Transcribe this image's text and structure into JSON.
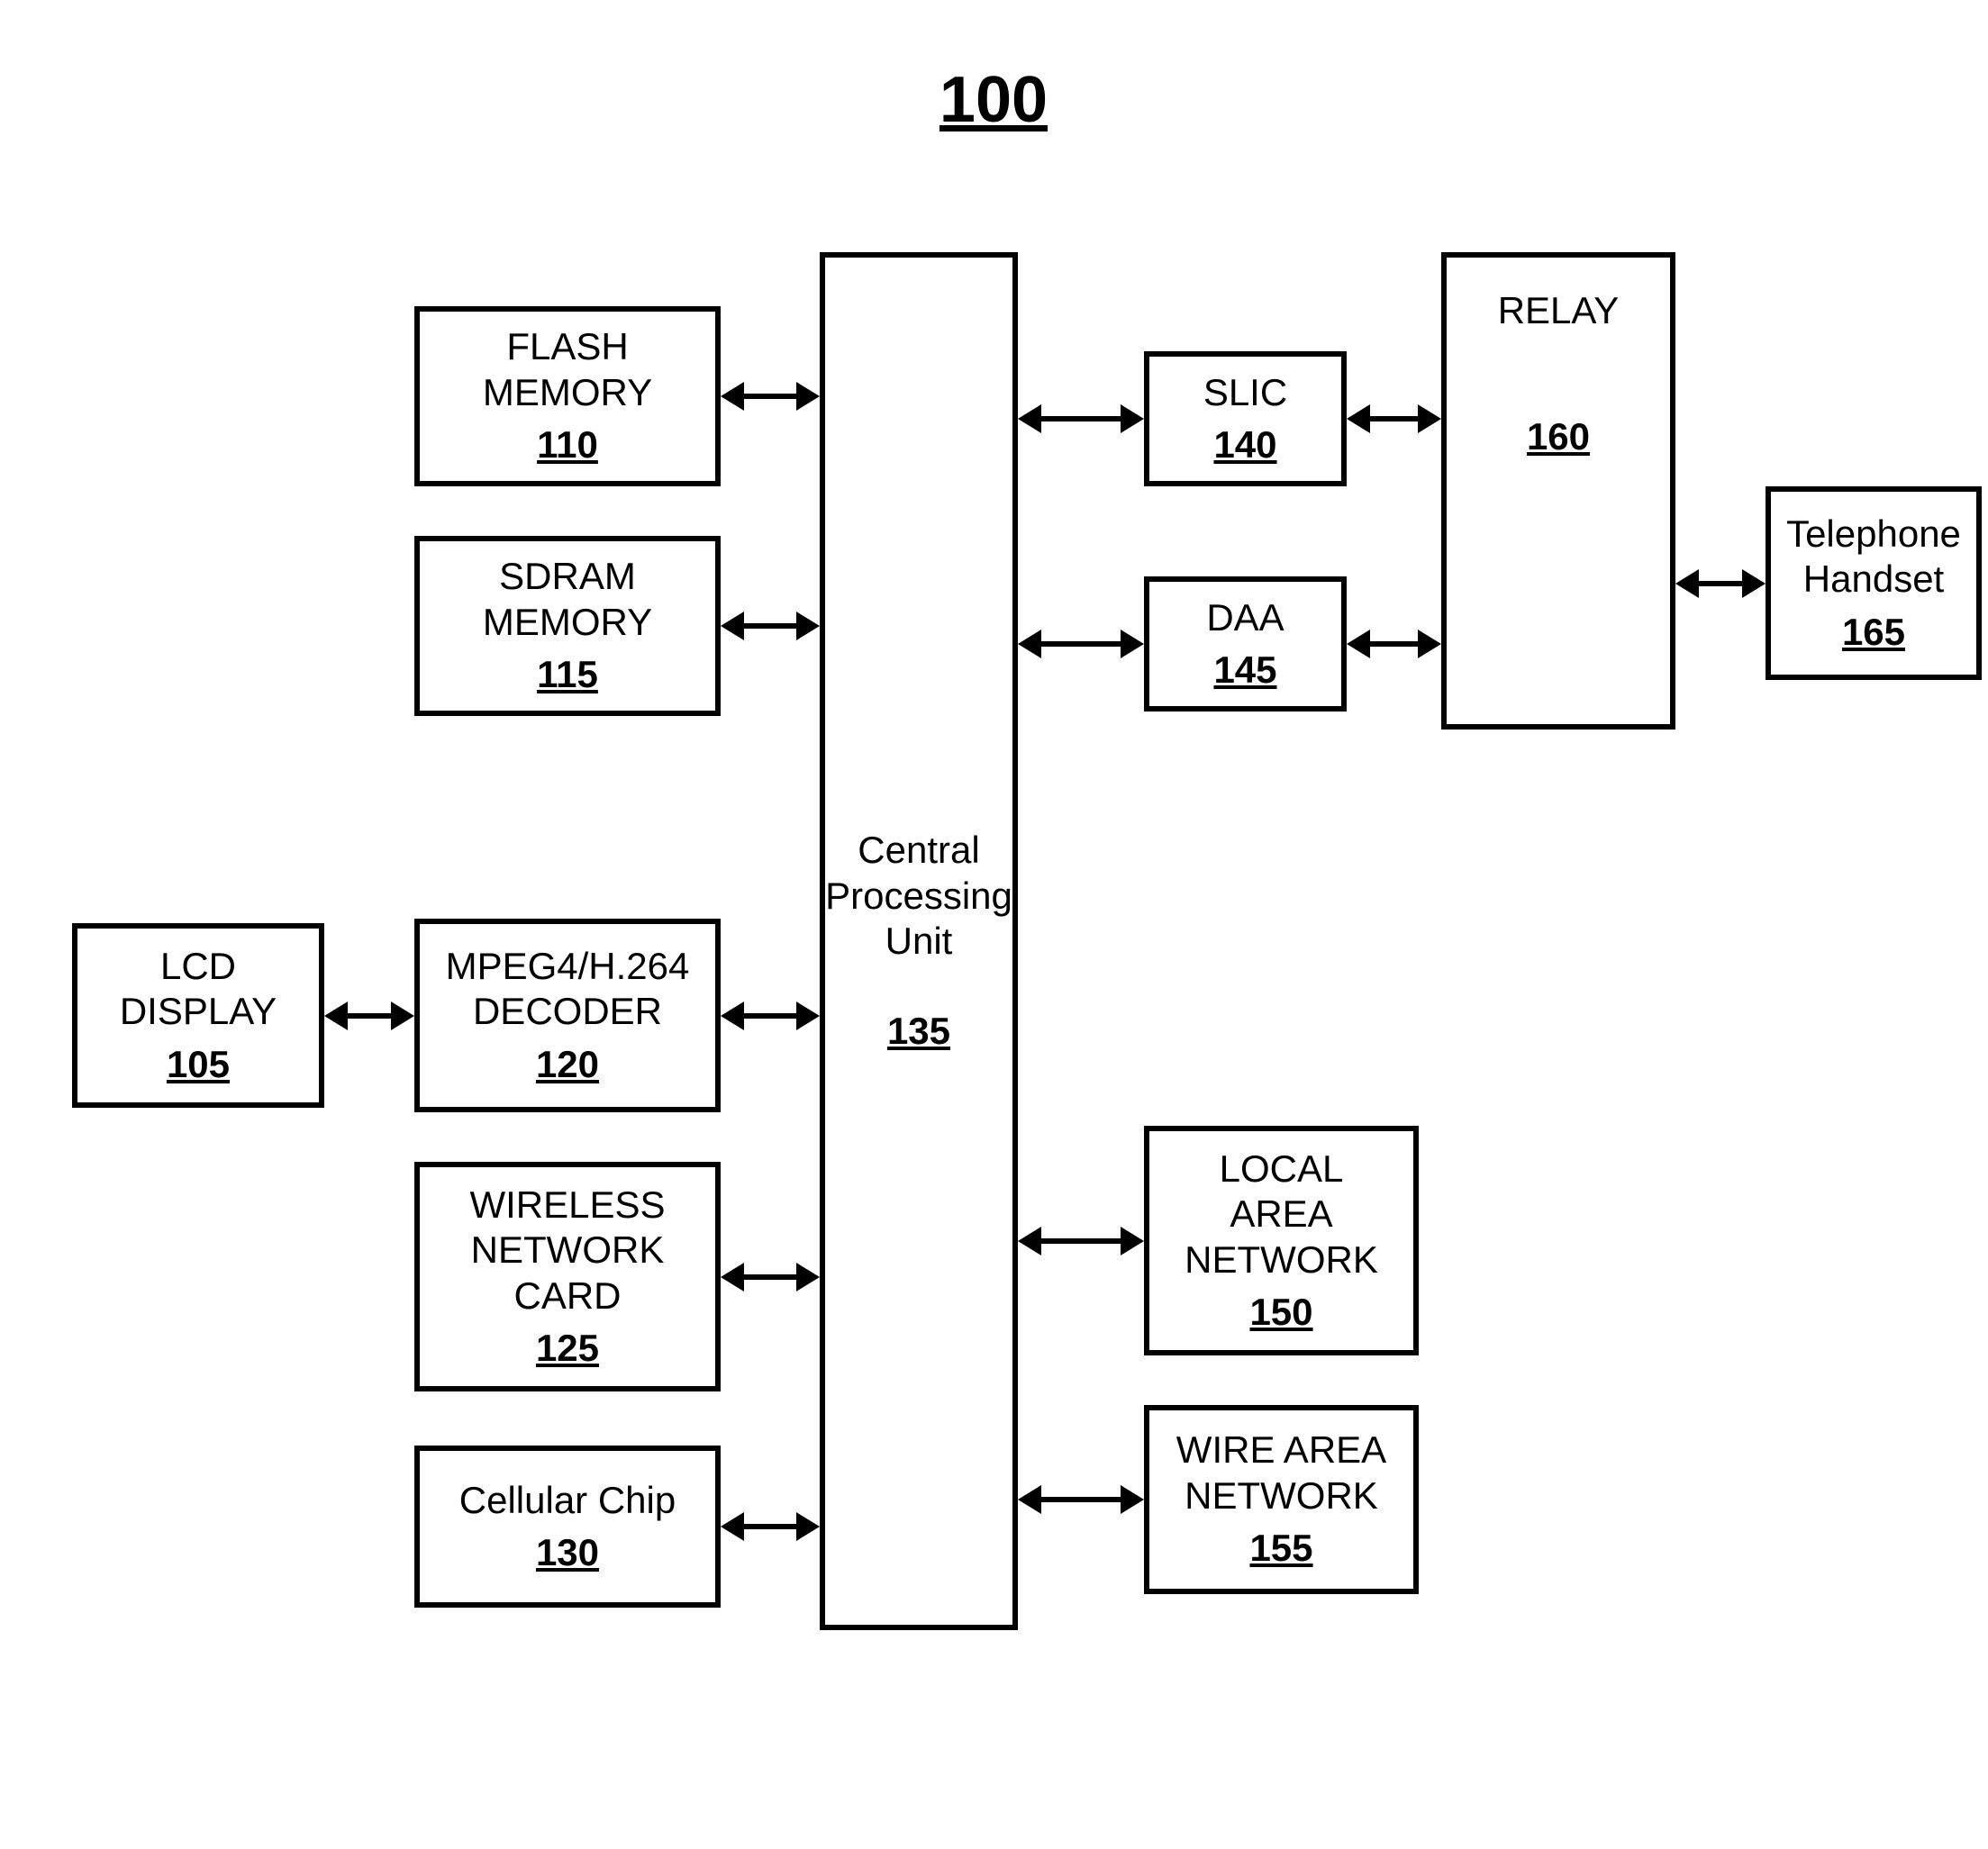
{
  "title": "100",
  "blocks": {
    "lcd": {
      "label": "LCD\nDISPLAY",
      "ref": "105"
    },
    "flash": {
      "label": "FLASH\nMEMORY",
      "ref": "110"
    },
    "sdram": {
      "label": "SDRAM\nMEMORY",
      "ref": "115"
    },
    "mpeg": {
      "label": "MPEG4/H.264\nDECODER",
      "ref": "120"
    },
    "wlan": {
      "label": "WIRELESS\nNETWORK\nCARD",
      "ref": "125"
    },
    "cell": {
      "label": "Cellular Chip",
      "ref": "130"
    },
    "cpu": {
      "label": "Central\nProcessing\nUnit",
      "ref": "135"
    },
    "slic": {
      "label": "SLIC",
      "ref": "140"
    },
    "daa": {
      "label": "DAA",
      "ref": "145"
    },
    "lan": {
      "label": "LOCAL\nAREA\nNETWORK",
      "ref": "150"
    },
    "wan": {
      "label": "WIRE AREA\nNETWORK",
      "ref": "155"
    },
    "relay": {
      "label": "RELAY",
      "ref": "160"
    },
    "phone": {
      "label": "Telephone\nHandset",
      "ref": "165"
    }
  }
}
